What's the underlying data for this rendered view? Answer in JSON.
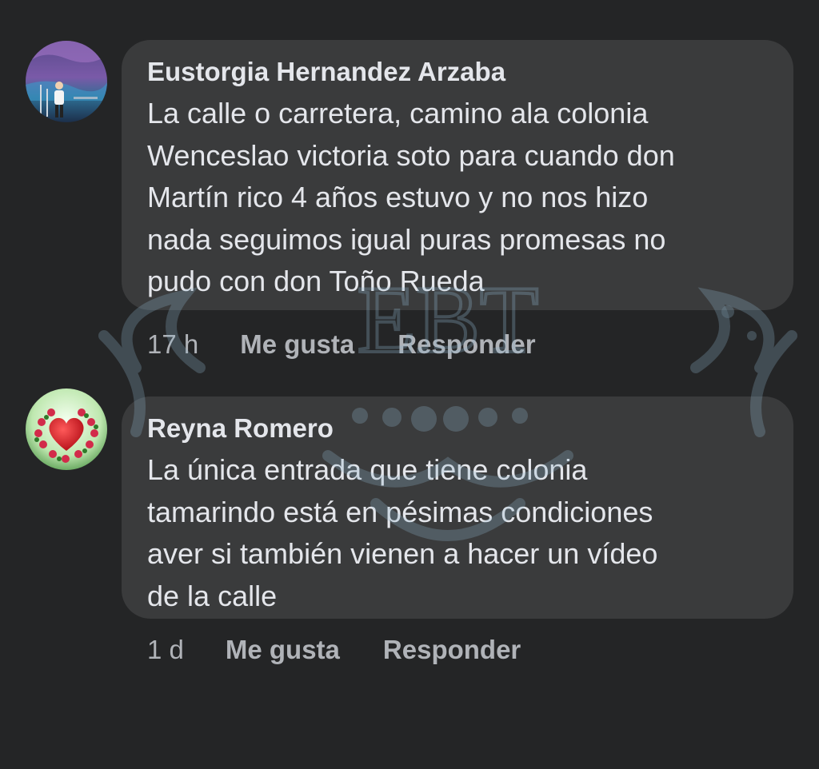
{
  "comments": [
    {
      "author": "Eustorgia Hernandez Arzaba",
      "text": "La calle o carretera, camino ala colonia\nWenceslao victoria soto para cuando don\nMartín rico 4 años estuvo y no nos hizo\nnada seguimos igual puras promesas no\npudo con don Toño Rueda",
      "time": "17 h",
      "like_label": "Me gusta",
      "reply_label": "Responder"
    },
    {
      "author": "Reyna Romero",
      "text": "La única entrada que tiene colonia\ntamarindo está en pésimas condiciones\naver si también vienen a hacer un vídeo\nde la calle",
      "time": "1 d",
      "like_label": "Me gusta",
      "reply_label": "Responder"
    }
  ],
  "watermark": {
    "text": "EBT",
    "color": "#8fb4cc"
  },
  "colors": {
    "background": "#242526",
    "bubble": "#3a3b3c",
    "primary_text": "#e4e6eb",
    "secondary_text": "#b0b3b8"
  }
}
